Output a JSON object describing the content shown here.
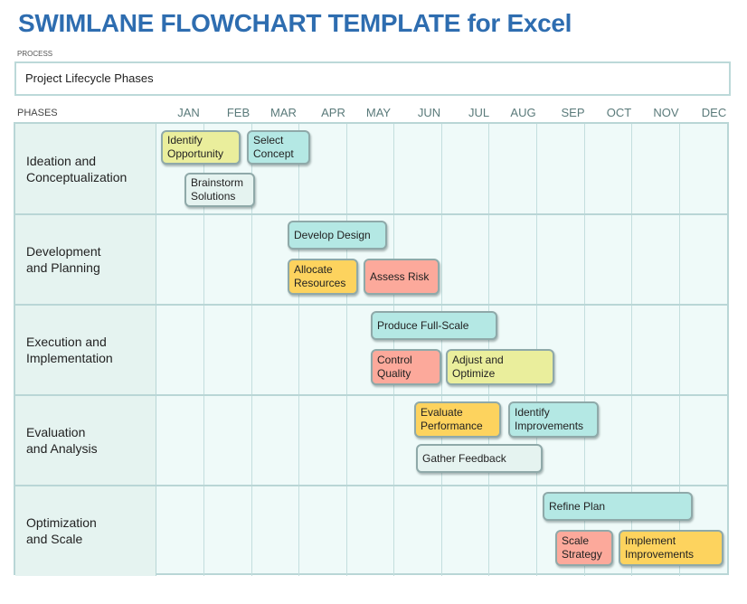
{
  "title": "SWIMLANE FLOWCHART TEMPLATE for Excel",
  "process": {
    "label": "PROCESS",
    "value": "Project Lifecycle Phases"
  },
  "phases_header": "PHASES",
  "months": [
    "JAN",
    "FEB",
    "MAR",
    "APR",
    "MAY",
    "JUN",
    "JUL",
    "AUG",
    "SEP",
    "OCT",
    "NOV",
    "DEC"
  ],
  "colors": {
    "title": "#2e6db0",
    "yellow": "#eaee9c",
    "cyan": "#b4e8e4",
    "gray": "#e5f3f0",
    "orange": "#fdd35e",
    "red": "#fca99b",
    "grid_line": "#b9d6d6"
  },
  "lanes": [
    {
      "label": "Ideation and\nConceptualization",
      "tasks": [
        {
          "text": "Identify\nOpportunity",
          "color": "yellow"
        },
        {
          "text": "Select\nConcept",
          "color": "cyan"
        },
        {
          "text": "Brainstorm\nSolutions",
          "color": "gray"
        }
      ]
    },
    {
      "label": "Development\nand Planning",
      "tasks": [
        {
          "text": "Develop Design",
          "color": "cyan"
        },
        {
          "text": "Allocate\nResources",
          "color": "orange"
        },
        {
          "text": "Assess Risk",
          "color": "red"
        }
      ]
    },
    {
      "label": "Execution and\nImplementation",
      "tasks": [
        {
          "text": "Produce Full-Scale",
          "color": "cyan"
        },
        {
          "text": "Control\nQuality",
          "color": "red"
        },
        {
          "text": "Adjust and\nOptimize",
          "color": "yellow"
        }
      ]
    },
    {
      "label": "Evaluation\nand Analysis",
      "tasks": [
        {
          "text": "Evaluate\nPerformance",
          "color": "orange"
        },
        {
          "text": "Identify\nImprovements",
          "color": "cyan"
        },
        {
          "text": "Gather Feedback",
          "color": "gray"
        }
      ]
    },
    {
      "label": "Optimization\nand Scale",
      "tasks": [
        {
          "text": "Refine Plan",
          "color": "cyan"
        },
        {
          "text": "Scale\nStrategy",
          "color": "red"
        },
        {
          "text": "Implement\nImprovements",
          "color": "orange"
        }
      ]
    }
  ]
}
